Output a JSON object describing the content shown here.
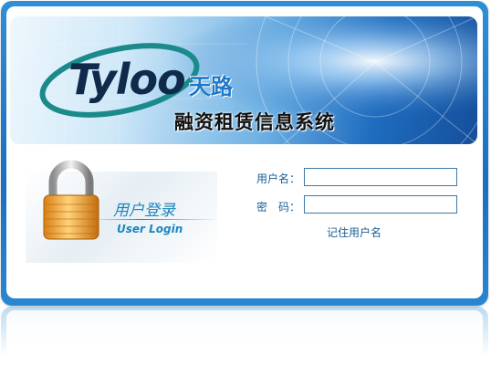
{
  "banner": {
    "logo_text": "Tyloo",
    "logo_cn": "天路",
    "system_title": "融资租赁信息系统"
  },
  "login_heading": {
    "cn": "用户登录",
    "en": "User Login"
  },
  "form": {
    "username_label": "用户名：",
    "username_value": "",
    "password_label": "密　码：",
    "password_value": "",
    "remember_label": "记住用户名"
  },
  "colors": {
    "frame_blue": "#1a6fbe",
    "label_blue": "#1a5f95",
    "heading_blue": "#1a86c0",
    "lock_gold": "#e8a23a"
  },
  "icons": {
    "lock": "padlock-icon"
  }
}
